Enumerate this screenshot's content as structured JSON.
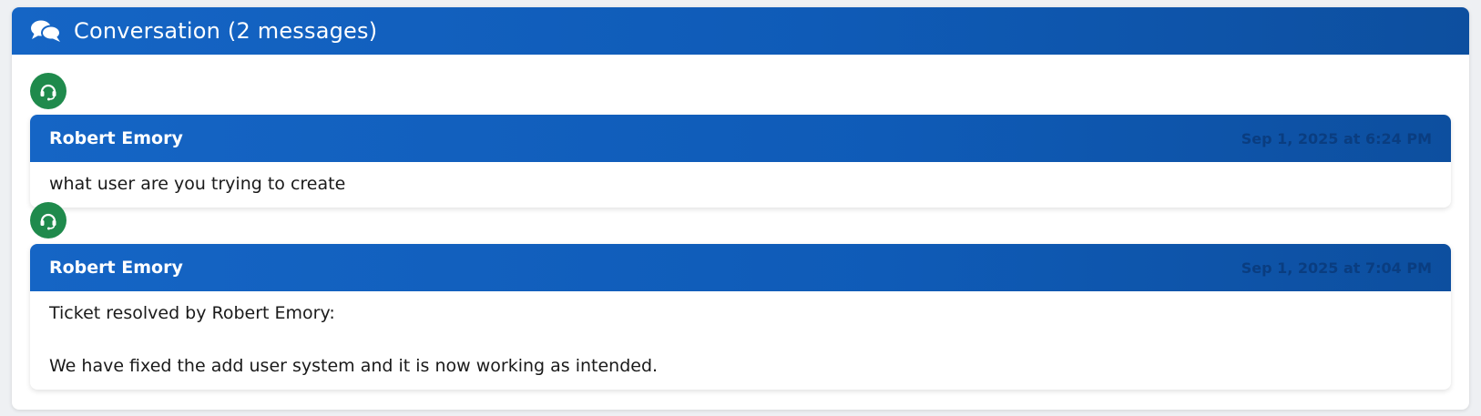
{
  "conversation": {
    "title": "Conversation (2 messages)",
    "header_icon": "comments-icon",
    "messages": [
      {
        "avatar_icon": "headset-icon",
        "author": "Robert Emory",
        "timestamp": "Sep 1, 2025 at 6:24 PM",
        "lines": [
          "what user are you trying to create"
        ]
      },
      {
        "avatar_icon": "headset-icon",
        "author": "Robert Emory",
        "timestamp": "Sep 1, 2025 at 7:04 PM",
        "lines": [
          "Ticket resolved by Robert Emory:",
          "We have fixed the add user system and it is now working as intended."
        ]
      }
    ]
  },
  "colors": {
    "header_blue": "#1565c5",
    "avatar_green": "#1f8a4c"
  }
}
